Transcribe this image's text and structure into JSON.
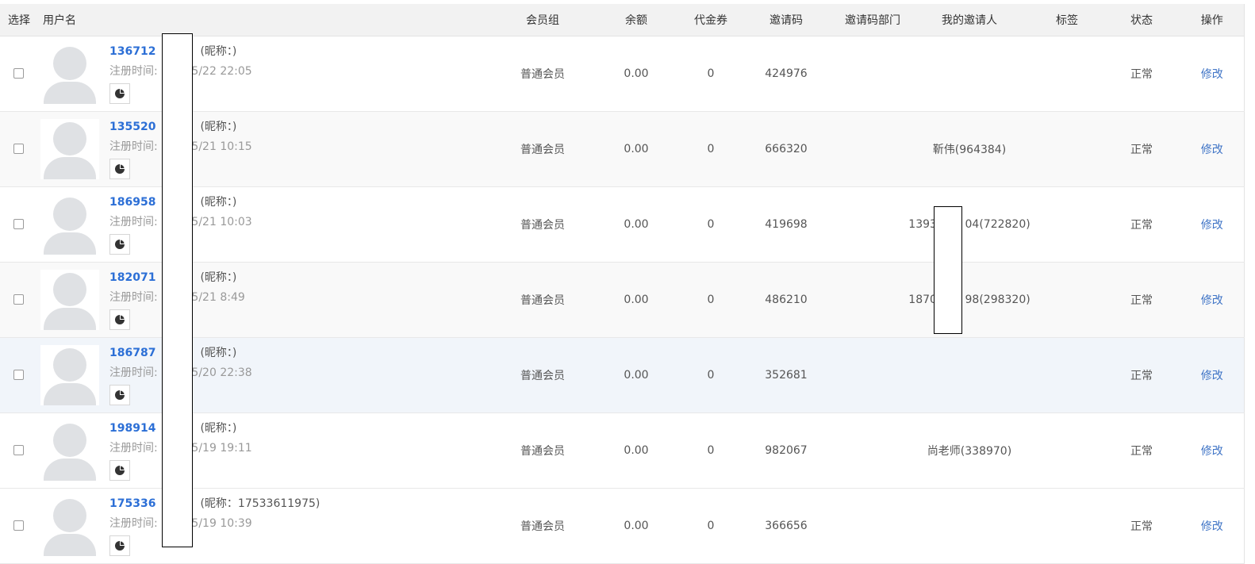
{
  "header": {
    "select": "选择",
    "username": "用户名",
    "group": "会员组",
    "balance": "余额",
    "voucher": "代金券",
    "invite_code": "邀请码",
    "invite_dept": "邀请码部门",
    "my_inviter": "我的邀请人",
    "tag": "标签",
    "status": "状态",
    "action": "操作"
  },
  "rows": [
    {
      "phone": "136712",
      "nick": "(昵称：)",
      "reg_label": "注册时间:",
      "reg_time": "/5/22 22:05",
      "group": "普通会员",
      "balance": "0.00",
      "voucher": "0",
      "invite_code": "424976",
      "invite_dept": "",
      "inviter": "",
      "tag": "",
      "status": "正常",
      "action": "修改"
    },
    {
      "phone": "135520",
      "nick": "(昵称：)",
      "reg_label": "注册时间:",
      "reg_time": "/5/21 10:15",
      "group": "普通会员",
      "balance": "0.00",
      "voucher": "0",
      "invite_code": "666320",
      "invite_dept": "",
      "inviter": "靳伟(964384)",
      "tag": "",
      "status": "正常",
      "action": "修改"
    },
    {
      "phone": "186958",
      "nick": "(昵称：)",
      "reg_label": "注册时间:",
      "reg_time": "/5/21 10:03",
      "group": "普通会员",
      "balance": "0.00",
      "voucher": "0",
      "invite_code": "419698",
      "invite_dept": "",
      "inviter": "13939      04(722820)",
      "tag": "",
      "status": "正常",
      "action": "修改"
    },
    {
      "phone": "182071",
      "nick": "(昵称：)",
      "reg_label": "注册时间:",
      "reg_time": "/5/21 8:49",
      "group": "普通会员",
      "balance": "0.00",
      "voucher": "0",
      "invite_code": "486210",
      "invite_dept": "",
      "inviter": "18707      98(298320)",
      "tag": "",
      "status": "正常",
      "action": "修改"
    },
    {
      "phone": "186787",
      "nick": "(昵称：)",
      "reg_label": "注册时间:",
      "reg_time": "/5/20 22:38",
      "group": "普通会员",
      "balance": "0.00",
      "voucher": "0",
      "invite_code": "352681",
      "invite_dept": "",
      "inviter": "",
      "tag": "",
      "status": "正常",
      "action": "修改"
    },
    {
      "phone": "198914",
      "nick": "(昵称：)",
      "reg_label": "注册时间:",
      "reg_time": "/5/19 19:11",
      "group": "普通会员",
      "balance": "0.00",
      "voucher": "0",
      "invite_code": "982067",
      "invite_dept": "",
      "inviter": "尚老师(338970)",
      "tag": "",
      "status": "正常",
      "action": "修改"
    },
    {
      "phone": "175336",
      "nick": "(昵称：17533611975)",
      "reg_label": "注册时间:",
      "reg_time": "/5/19 10:39",
      "group": "普通会员",
      "balance": "0.00",
      "voucher": "0",
      "invite_code": "366656",
      "invite_dept": "",
      "inviter": "",
      "tag": "",
      "status": "正常",
      "action": "修改"
    }
  ]
}
